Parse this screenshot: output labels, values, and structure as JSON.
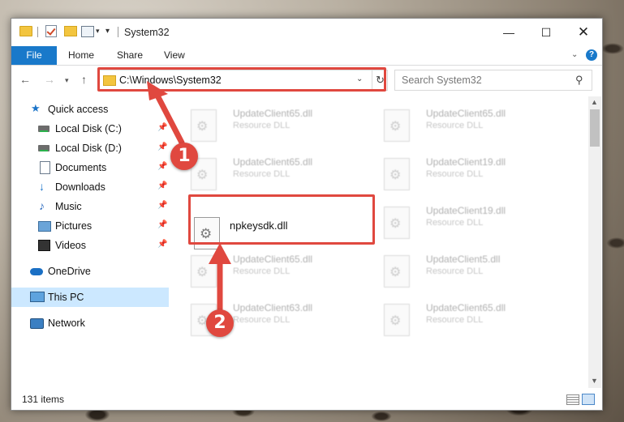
{
  "window": {
    "title": "System32"
  },
  "ribbon": {
    "file_label": "File",
    "home_label": "Home",
    "share_label": "Share",
    "view_label": "View"
  },
  "address": {
    "path": "C:\\Windows\\System32"
  },
  "search": {
    "placeholder": "Search System32"
  },
  "sidebar": {
    "items": [
      {
        "label": "Quick access",
        "icon": "star-icon"
      },
      {
        "label": "Local Disk (C:)",
        "icon": "drive-icon",
        "pinned": true
      },
      {
        "label": "Local Disk (D:)",
        "icon": "drive-icon",
        "pinned": true
      },
      {
        "label": "Documents",
        "icon": "documents-icon",
        "pinned": true
      },
      {
        "label": "Downloads",
        "icon": "download-icon",
        "pinned": true
      },
      {
        "label": "Music",
        "icon": "music-icon",
        "pinned": true
      },
      {
        "label": "Pictures",
        "icon": "pictures-icon",
        "pinned": true
      },
      {
        "label": "Videos",
        "icon": "videos-icon",
        "pinned": true
      },
      {
        "label": "OneDrive",
        "icon": "cloud-icon"
      },
      {
        "label": "This PC",
        "icon": "computer-icon",
        "selected": true
      },
      {
        "label": "Network",
        "icon": "network-icon"
      }
    ]
  },
  "files": {
    "left": [
      {
        "name": "UpdateClient65.dll",
        "type": "Resource DLL"
      },
      {
        "name": "UpdateClient65.dll",
        "type": "Resource DLL"
      },
      {
        "name": "UpdateClient65.dll",
        "type": "Resource DLL"
      },
      {
        "name": "UpdateClient63.dll",
        "type": "Resource DLL"
      }
    ],
    "right": [
      {
        "name": "UpdateClient65.dll",
        "type": "Resource DLL"
      },
      {
        "name": "UpdateClient19.dll",
        "type": "Resource DLL"
      },
      {
        "name": "UpdateClient19.dll",
        "type": "Resource DLL"
      },
      {
        "name": "UpdateClient5.dll",
        "type": "Resource DLL"
      },
      {
        "name": "UpdateClient65.dll",
        "type": "Resource DLL"
      }
    ],
    "highlighted": {
      "name": "npkeysdk.dll"
    }
  },
  "status": {
    "item_count": "131 items"
  },
  "callouts": {
    "first": "1",
    "second": "2"
  },
  "colors": {
    "accent": "#1979ca",
    "highlight": "#e0483f",
    "selected": "#cce8ff"
  }
}
